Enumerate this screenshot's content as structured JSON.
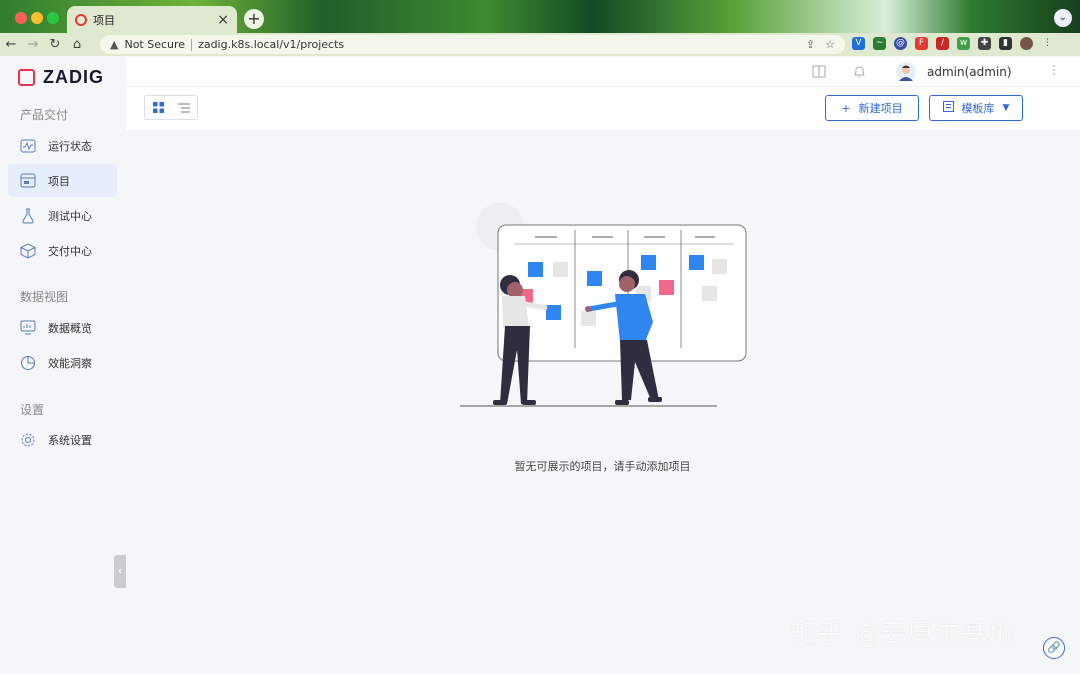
{
  "browser": {
    "tab_title": "项目",
    "new_tab": "+",
    "security": "Not Secure",
    "url": "zadig.k8s.local/v1/projects"
  },
  "app": {
    "logo_text": "ZADIG",
    "user": "admin(admin)",
    "sections": [
      {
        "title": "产品交付",
        "items": [
          {
            "label": "运行状态",
            "icon": "activity-icon"
          },
          {
            "label": "项目",
            "icon": "project-icon",
            "active": true
          },
          {
            "label": "测试中心",
            "icon": "flask-icon"
          },
          {
            "label": "交付中心",
            "icon": "package-icon"
          }
        ]
      },
      {
        "title": "数据视图",
        "items": [
          {
            "label": "数据概览",
            "icon": "monitor-icon"
          },
          {
            "label": "效能洞察",
            "icon": "pie-chart-icon"
          }
        ]
      },
      {
        "title": "设置",
        "items": [
          {
            "label": "系统设置",
            "icon": "gear-icon"
          }
        ]
      }
    ],
    "actions": {
      "new_project": "新建项目",
      "template_library": "模板库"
    },
    "empty_state": "暂无可展示的项目，请手动添加项目",
    "watermark": "知乎 @云原生基地"
  },
  "colors": {
    "accent": "#2f6bd6",
    "brand": "#e8344e",
    "sidebar_active": "#e6eefb"
  }
}
